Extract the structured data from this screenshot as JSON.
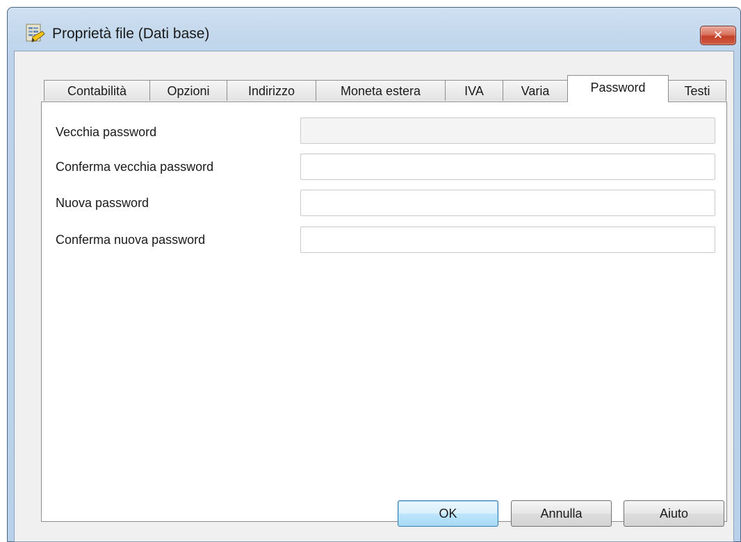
{
  "window": {
    "title": "Proprietà file (Dati base)",
    "close_label": "✕"
  },
  "tabs": [
    {
      "label": "Contabilità",
      "active": false
    },
    {
      "label": "Opzioni",
      "active": false
    },
    {
      "label": "Indirizzo",
      "active": false
    },
    {
      "label": "Moneta estera",
      "active": false
    },
    {
      "label": "IVA",
      "active": false
    },
    {
      "label": "Varia",
      "active": false
    },
    {
      "label": "Password",
      "active": true
    },
    {
      "label": "Testi",
      "active": false
    }
  ],
  "form": {
    "old_password": {
      "label": "Vecchia password",
      "value": "",
      "disabled": true
    },
    "confirm_old_password": {
      "label": "Conferma vecchia password",
      "value": ""
    },
    "new_password": {
      "label": "Nuova password",
      "value": ""
    },
    "confirm_new_password": {
      "label": "Conferma nuova password",
      "value": ""
    }
  },
  "buttons": {
    "ok": "OK",
    "cancel": "Annulla",
    "help": "Aiuto"
  },
  "colors": {
    "titlebar": "#bcd3ea",
    "close_button": "#c4402a",
    "default_button_border": "#3c7fb1"
  },
  "icons": {
    "app": "database-file-icon",
    "close": "close-icon"
  }
}
